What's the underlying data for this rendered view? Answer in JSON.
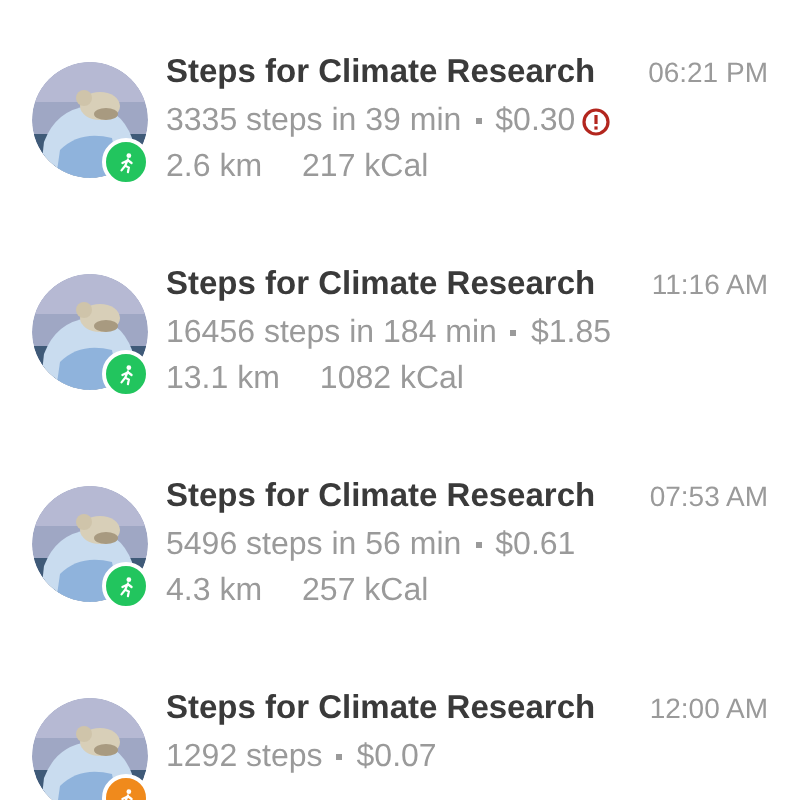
{
  "activities": [
    {
      "title": "Steps for Climate Research",
      "time": "06:21 PM",
      "steps": "3335 steps in 39 min",
      "amount": "$0.30",
      "warning": true,
      "distance": "2.6 km",
      "calories": "217 kCal",
      "color": "#22c55e"
    },
    {
      "title": "Steps for Climate Research",
      "time": "11:16 AM",
      "steps": "16456 steps in 184 min",
      "amount": "$1.85",
      "warning": false,
      "distance": "13.1 km",
      "calories": "1082 kCal",
      "color": "#22c55e"
    },
    {
      "title": "Steps for Climate Research",
      "time": "07:53 AM",
      "steps": "5496 steps in 56 min",
      "amount": "$0.61",
      "warning": false,
      "distance": "4.3 km",
      "calories": "257 kCal",
      "color": "#22c55e"
    },
    {
      "title": "Steps for Climate Research",
      "time": "12:00 AM",
      "steps": "1292 steps",
      "amount": "$0.07",
      "warning": false,
      "color": "#f08a1c"
    }
  ]
}
